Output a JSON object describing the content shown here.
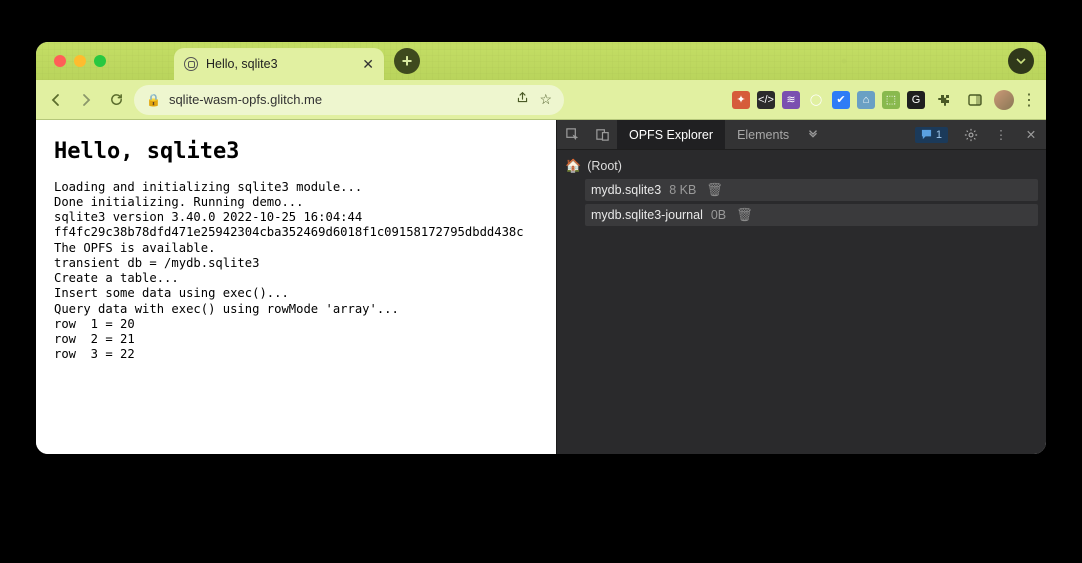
{
  "tab": {
    "title": "Hello, sqlite3"
  },
  "url": "sqlite-wasm-opfs.glitch.me",
  "page": {
    "heading": "Hello, sqlite3",
    "lines": [
      "Loading and initializing sqlite3 module...",
      "Done initializing. Running demo...",
      "sqlite3 version 3.40.0 2022-10-25 16:04:44",
      "ff4fc29c38b78dfd471e25942304cba352469d6018f1c09158172795dbdd438c",
      "The OPFS is available.",
      "transient db = /mydb.sqlite3",
      "Create a table...",
      "Insert some data using exec()...",
      "Query data with exec() using rowMode 'array'...",
      "row  1 = 20",
      "row  2 = 21",
      "row  3 = 22"
    ]
  },
  "devtools": {
    "tabs": {
      "active": "OPFS Explorer",
      "next": "Elements"
    },
    "msg_count": "1",
    "root_label": "(Root)",
    "files": [
      {
        "name": "mydb.sqlite3",
        "size": "8 KB"
      },
      {
        "name": "mydb.sqlite3-journal",
        "size": "0B"
      }
    ]
  },
  "extensions": [
    {
      "bg": "#d65b3a",
      "glyph": "✦"
    },
    {
      "bg": "#2b2b2b",
      "glyph": "</>"
    },
    {
      "bg": "#7a4fb0",
      "glyph": "≋"
    },
    {
      "bg": "#e1f0a1",
      "glyph": "◯"
    },
    {
      "bg": "#2e7cf6",
      "glyph": "✔"
    },
    {
      "bg": "#6aa0c4",
      "glyph": "⌂"
    },
    {
      "bg": "#89b94e",
      "glyph": "⬚"
    },
    {
      "bg": "#1f1f1f",
      "glyph": "G"
    }
  ]
}
